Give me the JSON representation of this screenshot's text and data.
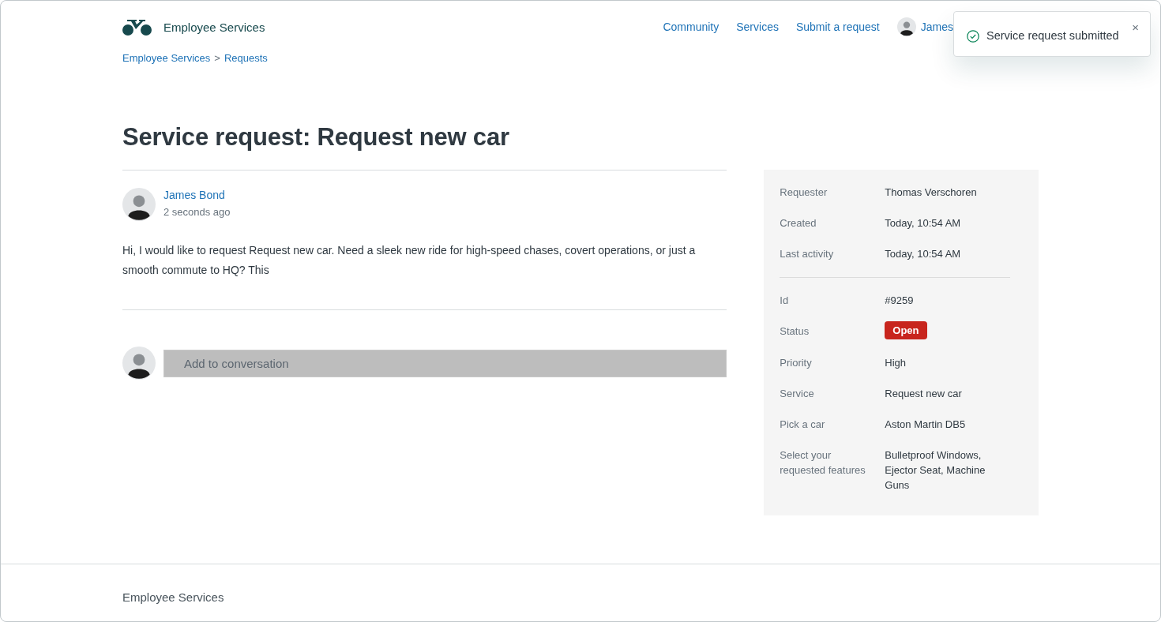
{
  "header": {
    "brand": "Employee Services",
    "nav": [
      "Community",
      "Services",
      "Submit a request"
    ],
    "user": "James"
  },
  "breadcrumbs": [
    "Employee Services",
    "Requests"
  ],
  "breadcrumb_separator": ">",
  "title": "Service request: Request new car",
  "comment": {
    "author": "James Bond",
    "time": "2 seconds ago",
    "body": "Hi, I would like to request Request new car. Need a sleek new ride for high-speed chases, covert operations, or just a smooth commute to HQ? This"
  },
  "reply": {
    "placeholder": "Add to conversation"
  },
  "details": [
    [
      {
        "kind": "text",
        "label": "Requester",
        "value": "Thomas Verschoren"
      },
      {
        "kind": "text",
        "label": "Created",
        "value": "Today, 10:54 AM"
      },
      {
        "kind": "text",
        "label": "Last activity",
        "value": "Today, 10:54 AM"
      }
    ],
    [
      {
        "kind": "text",
        "label": "Id",
        "value": "#9259"
      },
      {
        "kind": "badge",
        "label": "Status",
        "value": "Open",
        "color": "#c8251d"
      },
      {
        "kind": "text",
        "label": "Priority",
        "value": "High"
      },
      {
        "kind": "text",
        "label": "Service",
        "value": "Request new car"
      },
      {
        "kind": "text",
        "label": "Pick a car",
        "value": "Aston Martin DB5"
      },
      {
        "kind": "text",
        "label": "Select your requested features",
        "value": "Bulletproof Windows, Ejector Seat, Machine Guns"
      }
    ]
  ],
  "toast": {
    "message": "Service request submitted",
    "close": "×"
  },
  "footer": {
    "text": "Employee Services"
  }
}
